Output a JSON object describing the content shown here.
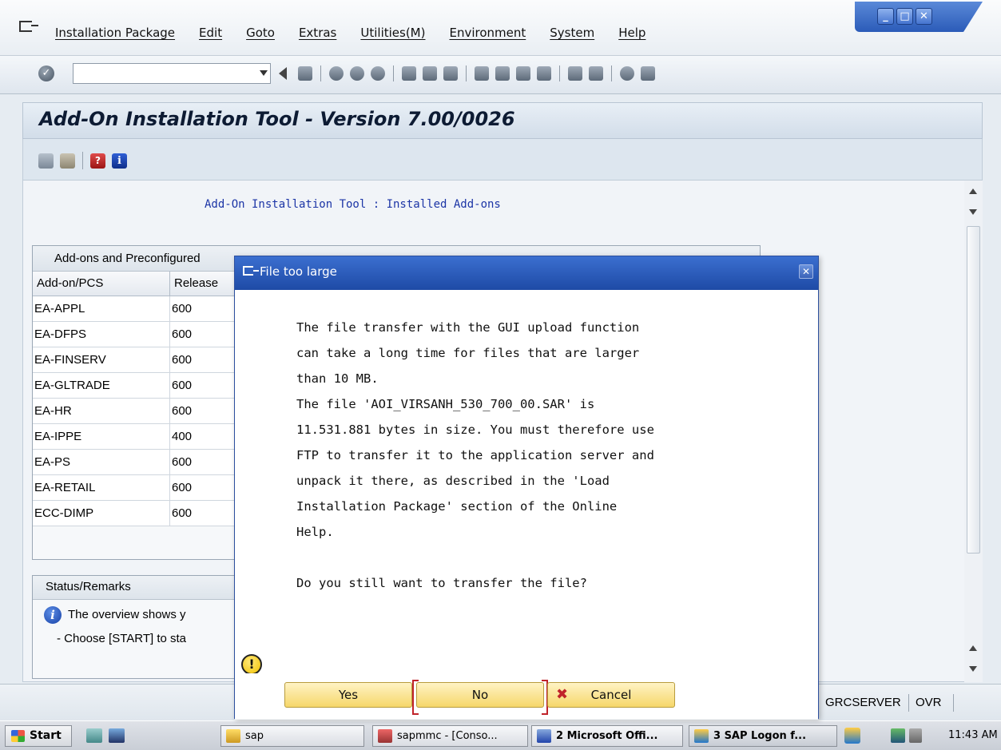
{
  "menubar": {
    "items": [
      "Installation Package",
      "Edit",
      "Goto",
      "Extras",
      "Utilities(M)",
      "Environment",
      "System",
      "Help"
    ]
  },
  "window_controls": {
    "minimize": "_",
    "maximize": "□",
    "close": "✕"
  },
  "toolbar": {
    "command_field_value": ""
  },
  "page": {
    "title": "Add-On Installation Tool - Version 7.00/0026",
    "heading": "Add-On Installation Tool : Installed Add-ons"
  },
  "addons_group": {
    "title": "Add-ons and Preconfigured",
    "columns": [
      "Add-on/PCS",
      "Release"
    ],
    "rows": [
      [
        "EA-APPL",
        "600"
      ],
      [
        "EA-DFPS",
        "600"
      ],
      [
        "EA-FINSERV",
        "600"
      ],
      [
        "EA-GLTRADE",
        "600"
      ],
      [
        "EA-HR",
        "600"
      ],
      [
        "EA-IPPE",
        "400"
      ],
      [
        "EA-PS",
        "600"
      ],
      [
        "EA-RETAIL",
        "600"
      ],
      [
        "ECC-DIMP",
        "600"
      ]
    ]
  },
  "status_group": {
    "title": "Status/Remarks",
    "line1": "The overview shows y",
    "line2": "- Choose [START] to sta"
  },
  "dialog": {
    "title": "File too large",
    "lines": [
      "The file transfer with the GUI upload function",
      "can take a long time for files that are larger",
      "than 10 MB.",
      "The file 'AOI_VIRSANH_530_700_00.SAR' is",
      "11.531.881 bytes in size. You must therefore use",
      "FTP to transfer it to the application server and",
      "unpack it there, as described in the 'Load",
      "Installation Package' section of the Online",
      "Help."
    ],
    "question": "Do you still want to transfer the file?",
    "buttons": {
      "yes": "Yes",
      "no": "No",
      "cancel": "Cancel"
    }
  },
  "statusbar": {
    "server": "GRCSERVER",
    "mode": "OVR"
  },
  "taskbar": {
    "start": "Start",
    "items": [
      "sap",
      "sapmmc - [Conso...",
      "2 Microsoft Offi...",
      "3 SAP Logon f..."
    ],
    "clock": "11:43 AM"
  },
  "colors": {
    "dialog_title": "#1e4aa6",
    "button_yellow": "#f6d76a",
    "focus_frame": "#c0232a",
    "heading_blue": "#1c35a6"
  }
}
